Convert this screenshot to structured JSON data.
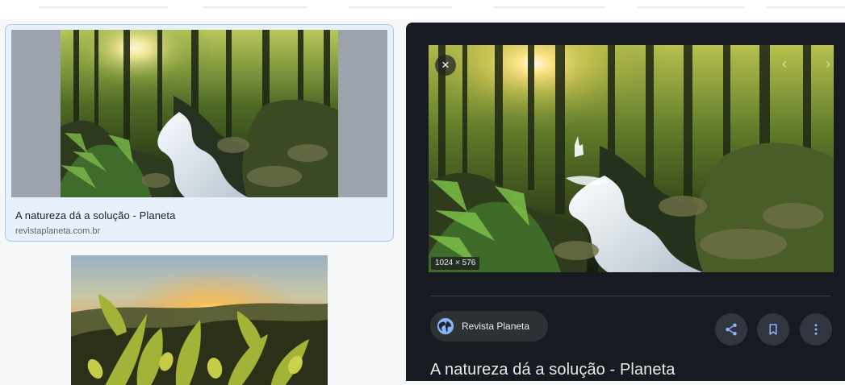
{
  "left_results": {
    "items": [
      {
        "title": "A natureza dá a solução - Planeta",
        "source": "revistaplaneta.com.br"
      }
    ]
  },
  "viewer": {
    "dimensions": "1024 × 576",
    "source_name": "Revista Planeta",
    "title": "A natureza dá a solução - Planeta",
    "icons": {
      "close": "close-icon",
      "prev": "chevron-left-icon",
      "next": "chevron-right-icon",
      "globe": "globe-icon",
      "share": "share-icon",
      "save": "bookmark-icon",
      "more": "more-vert-icon"
    }
  },
  "colors": {
    "selected_card_bg": "#e8f0fb",
    "selected_card_border": "#a6c6f1",
    "viewer_bg": "#171a20",
    "icon_blue": "#8ab4f8"
  }
}
